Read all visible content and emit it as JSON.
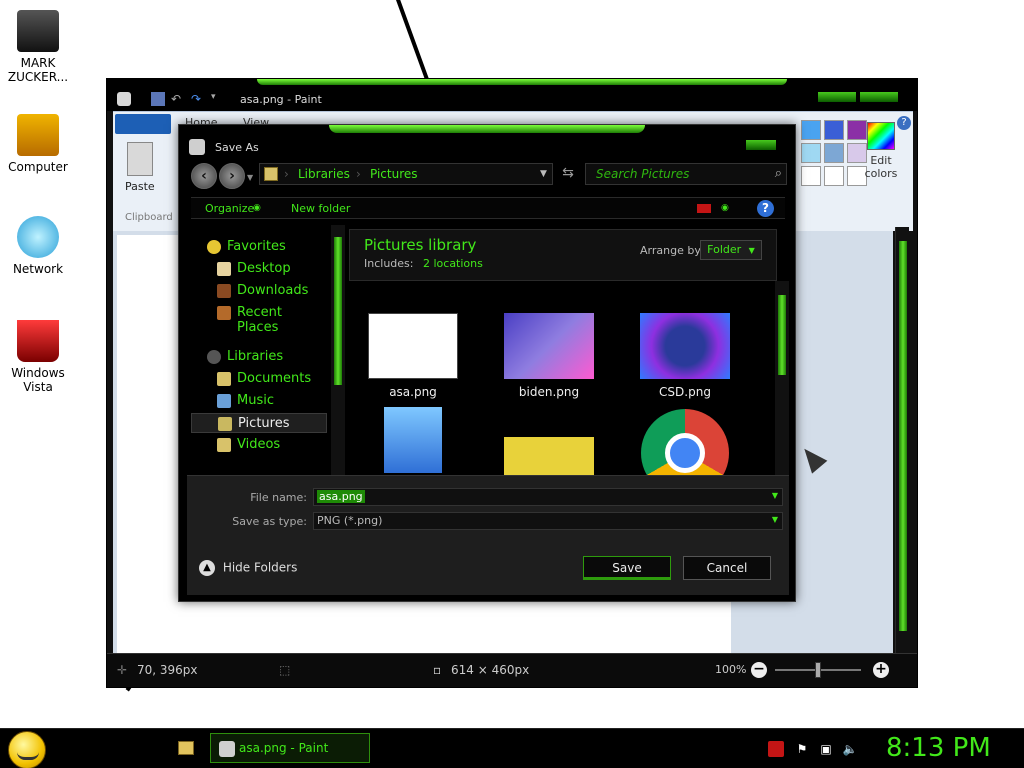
{
  "desktop": {
    "icons": [
      {
        "label": "MARK ZUCKER..."
      },
      {
        "label": "Computer"
      },
      {
        "label": "Network"
      },
      {
        "label": "Windows Vista"
      }
    ]
  },
  "paint": {
    "title": "asa.png - Paint",
    "tabs": [
      "Home",
      "View"
    ],
    "paste_label": "Paste",
    "clipboard_label": "Clipboard",
    "edit_colors_label": "Edit colors",
    "palette_colors": [
      "#4aa3f0",
      "#3b5fd6",
      "#8b2fa6",
      "#9fd8f2",
      "#7da7d4",
      "#d8c9ea",
      "#ffffff",
      "#ffffff",
      "#ffffff"
    ],
    "status": {
      "cursor_pos": "70, 396px",
      "dimensions": "614 × 460px",
      "zoom": "100%"
    }
  },
  "dialog": {
    "title": "Save As",
    "address": {
      "root": "Libraries",
      "current": "Pictures"
    },
    "search_placeholder": "Search Pictures",
    "toolbar": {
      "organize": "Organize",
      "new_folder": "New folder"
    },
    "nav": {
      "favorites_header": "Favorites",
      "favorites": [
        "Desktop",
        "Downloads",
        "Recent Places"
      ],
      "libraries_header": "Libraries",
      "libraries": [
        "Documents",
        "Music",
        "Pictures",
        "Videos"
      ],
      "selected": "Pictures"
    },
    "library": {
      "title": "Pictures library",
      "includes_label": "Includes:",
      "includes_link": "2 locations",
      "arrange_label": "Arrange by:",
      "arrange_value": "Folder"
    },
    "files": [
      {
        "name": "asa.png"
      },
      {
        "name": "biden.png"
      },
      {
        "name": "CSD.png"
      },
      {
        "name": ""
      },
      {
        "name": ""
      },
      {
        "name": ""
      }
    ],
    "file_name_label": "File name:",
    "file_name_value": "asa.png",
    "save_type_label": "Save as type:",
    "save_type_value": "PNG (*.png)",
    "hide_folders": "Hide Folders",
    "save_button": "Save",
    "cancel_button": "Cancel"
  },
  "taskbar": {
    "task_label": "asa.png - Paint",
    "clock": "8:13 PM"
  }
}
